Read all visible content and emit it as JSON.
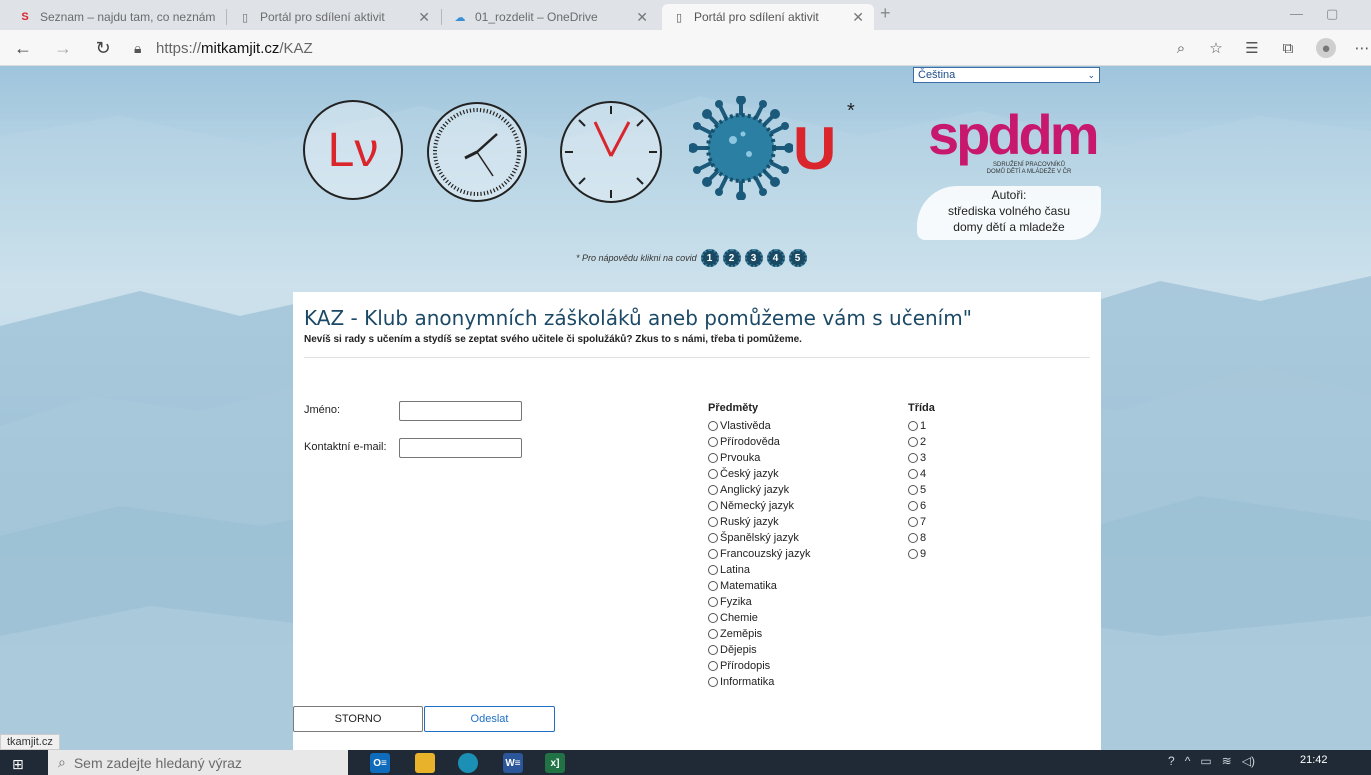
{
  "browser": {
    "tabs": [
      {
        "title": "Seznam – najdu tam, co neznám",
        "icon": "seznam-icon",
        "active": false
      },
      {
        "title": "Portál pro sdílení aktivit",
        "icon": "page-icon",
        "active": false
      },
      {
        "title": "01_rozdelit – OneDrive",
        "icon": "cloud-icon",
        "active": false
      },
      {
        "title": "Portál pro sdílení aktivit",
        "icon": "page-icon",
        "active": true
      }
    ],
    "url_prefix": "https://",
    "url_host": "mitkamjit.cz",
    "url_path": "/KAZ",
    "status_url": "tkamjit.cz"
  },
  "header": {
    "language": "Čeština",
    "logo_letters": "Lν",
    "u_letter": "U",
    "asterisk": "*",
    "org_logo_text": "spddm",
    "org_sub_line1": "SDRUŽENÍ PRACOVNÍKŮ",
    "org_sub_line2": "DOMŮ DĚTÍ A MLÁDEŽE V ČR",
    "authors_line1": "Autoři:",
    "authors_line2": "střediska volného času",
    "authors_line3": "domy dětí a mladeže",
    "help_text": "* Pro nápovědu klikni na covid",
    "help_numbers": [
      "1",
      "2",
      "3",
      "4",
      "5"
    ]
  },
  "form": {
    "title": "KAZ - Klub anonymních záškoláků aneb pomůžeme vám s učením\"",
    "subtitle": "Nevíš si rady s učením a stydíš se zeptat svého učitele či spolužáků? Zkus to s námi, třeba ti pomůžeme.",
    "name_label": "Jméno:",
    "email_label": "Kontaktní e-mail:",
    "name_value": "",
    "email_value": "",
    "subjects_header": "Předměty",
    "subjects": [
      "Vlastivěda",
      "Přírodověda",
      "Prvouka",
      "Český jazyk",
      "Anglický jazyk",
      "Německý jazyk",
      "Ruský jazyk",
      "Španělský jazyk",
      "Francouzský jazyk",
      "Latina",
      "Matematika",
      "Fyzika",
      "Chemie",
      "Zeměpis",
      "Dějepis",
      "Přírodopis",
      "Informatika"
    ],
    "grade_header": "Třída",
    "grades": [
      "1",
      "2",
      "3",
      "4",
      "5",
      "6",
      "7",
      "8",
      "9"
    ],
    "cancel_label": "STORNO",
    "submit_label": "Odeslat"
  },
  "taskbar": {
    "search_placeholder": "Sem zadejte hledaný výraz",
    "time": "21:42",
    "apps": [
      "O≡",
      "W≡",
      "x]"
    ]
  },
  "colors": {
    "accent_red": "#d9252b",
    "title_blue": "#1c4a66",
    "logo_pink": "#c8186e",
    "button_blue": "#1f6fc5"
  }
}
